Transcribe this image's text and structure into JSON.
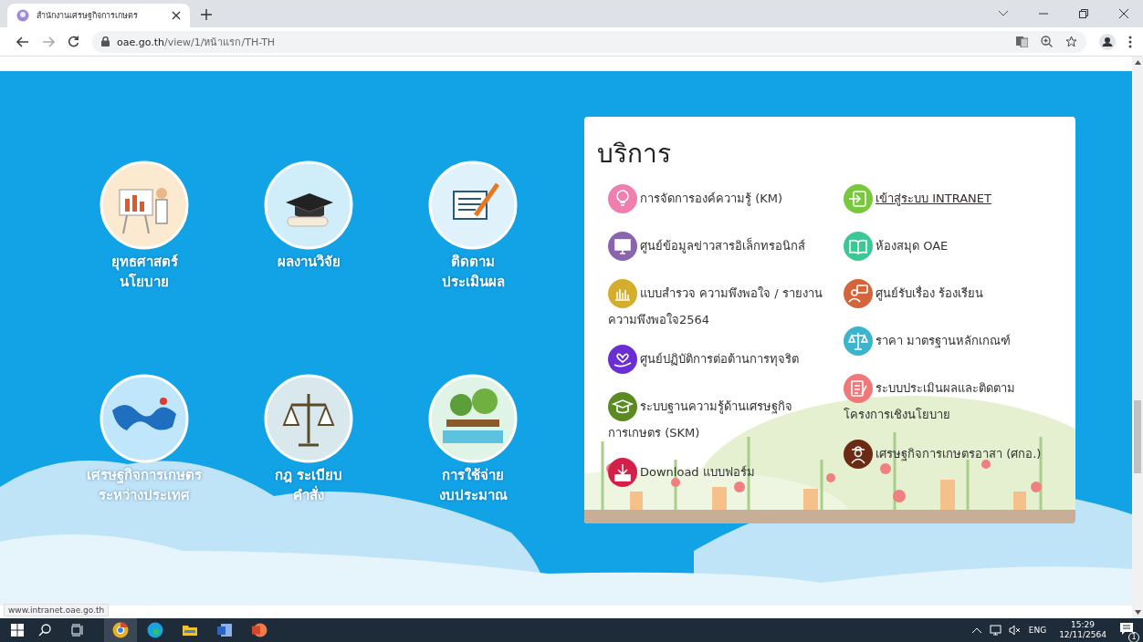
{
  "browser": {
    "tab_title": "สำนักงานเศรษฐกิจการเกษตร",
    "host": "oae.go.th",
    "path": "/view/1/หน้าแรก/TH-TH"
  },
  "topics": [
    {
      "kind": "strategy",
      "lines": [
        "ยุทธศาสตร์",
        "นโยบาย"
      ]
    },
    {
      "kind": "research",
      "lines": [
        "ผลงานวิจัย"
      ]
    },
    {
      "kind": "evaluation",
      "lines": [
        "ติดตาม",
        "ประเมินผล"
      ]
    },
    {
      "kind": "world",
      "lines": [
        "เศรษฐกิจการเกษตร",
        "ระหว่างประเทศ"
      ]
    },
    {
      "kind": "law",
      "lines": [
        "กฎ ระเบียบ",
        "คำสั่ง"
      ]
    },
    {
      "kind": "budget",
      "lines": [
        "การใช้จ่าย",
        "งบประมาณ"
      ]
    }
  ],
  "services": {
    "title": "บริการ",
    "columns": [
      [
        {
          "kind": "idea",
          "label": "การจัดการองค์ความรู้ (KM)",
          "color": "#f07fb0",
          "hovered": false
        },
        {
          "kind": "monitor",
          "label": "ศูนย์ข้อมูลข่าวสารอิเล็กทรอนิกส์",
          "color": "#8a64ac",
          "hovered": false
        },
        {
          "kind": "chart",
          "label": "แบบสำรวจ ความพึงพอใจ / รายงานความพึงพอใจ2564",
          "color": "#d4ad2c",
          "hovered": false
        },
        {
          "kind": "heart",
          "label": "ศูนย์ปฏิบัติการต่อต้านการทุจริต",
          "color": "#6a2fd4",
          "hovered": false
        },
        {
          "kind": "cap",
          "label": "ระบบฐานความรู้ด้านเศรษฐกิจการเกษตร (SKM)",
          "color": "#5c8a22",
          "hovered": false
        },
        {
          "kind": "download",
          "label": "Download แบบฟอร์ม",
          "color": "#d42048",
          "hovered": false
        }
      ],
      [
        {
          "kind": "login",
          "label": "เข้าสู่ระบบ INTRANET",
          "color": "#78c83c",
          "hovered": true
        },
        {
          "kind": "book",
          "label": "ห้องสมุด OAE",
          "color": "#3cc896",
          "hovered": false
        },
        {
          "kind": "chat",
          "label": "ศูนย์รับเรื่อง ร้องเรียน",
          "color": "#d4643a",
          "hovered": false
        },
        {
          "kind": "scale",
          "label": "ราคา มาตรฐานหลักเกณฑ์",
          "color": "#3cb4cc",
          "hovered": false
        },
        {
          "kind": "clipboard",
          "label": "ระบบประเมินผลและติดตามโครงการเชิงนโยบาย",
          "color": "#f07878",
          "hovered": false
        },
        {
          "kind": "farmer",
          "label": "เศรษฐกิจการเกษตรอาสา (ศกอ.)",
          "color": "#6a2a14",
          "hovered": false
        }
      ]
    ]
  },
  "status_url": "www.intranet.oae.go.th",
  "taskbar": {
    "apps": [
      {
        "kind": "chrome",
        "selected": true
      },
      {
        "kind": "edge",
        "selected": false
      },
      {
        "kind": "folder",
        "selected": false
      },
      {
        "kind": "word",
        "selected": false
      },
      {
        "kind": "powerpoint",
        "selected": false
      }
    ],
    "language": "ENG",
    "time": "15:29",
    "date": "12/11/2564",
    "notification_count": "1"
  }
}
